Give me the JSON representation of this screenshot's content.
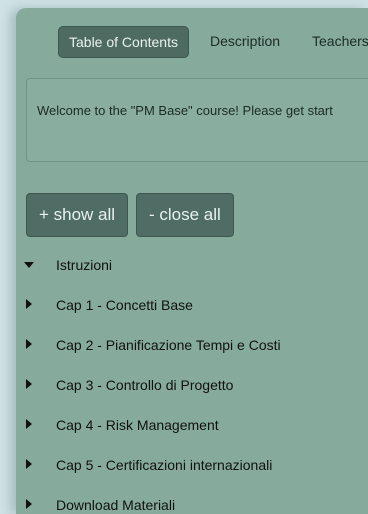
{
  "tabs": [
    {
      "label": "Table of Contents",
      "active": true
    },
    {
      "label": "Description",
      "active": false
    },
    {
      "label": "Teachers",
      "active": false
    }
  ],
  "welcome": {
    "text": "Welcome to the \"PM Base\" course! Please get start"
  },
  "buttons": {
    "show_all": "+ show all",
    "close_all": "- close all"
  },
  "tree": {
    "items": [
      {
        "label": "Istruzioni",
        "expanded": true
      },
      {
        "label": "Cap 1 - Concetti Base",
        "expanded": false
      },
      {
        "label": "Cap 2 - Pianificazione Tempi e Costi",
        "expanded": false
      },
      {
        "label": "Cap 3 - Controllo di Progetto",
        "expanded": false
      },
      {
        "label": "Cap 4 - Risk Management",
        "expanded": false
      },
      {
        "label": "Cap 5 - Certificazioni internazionali",
        "expanded": false
      },
      {
        "label": "Download Materiali",
        "expanded": false
      }
    ]
  },
  "colors": {
    "panel_bg": "#86ab9d",
    "active_tab_bg": "#4e6b62",
    "button_bg": "#4f6d64",
    "page_bg": "#cfe2e6"
  }
}
